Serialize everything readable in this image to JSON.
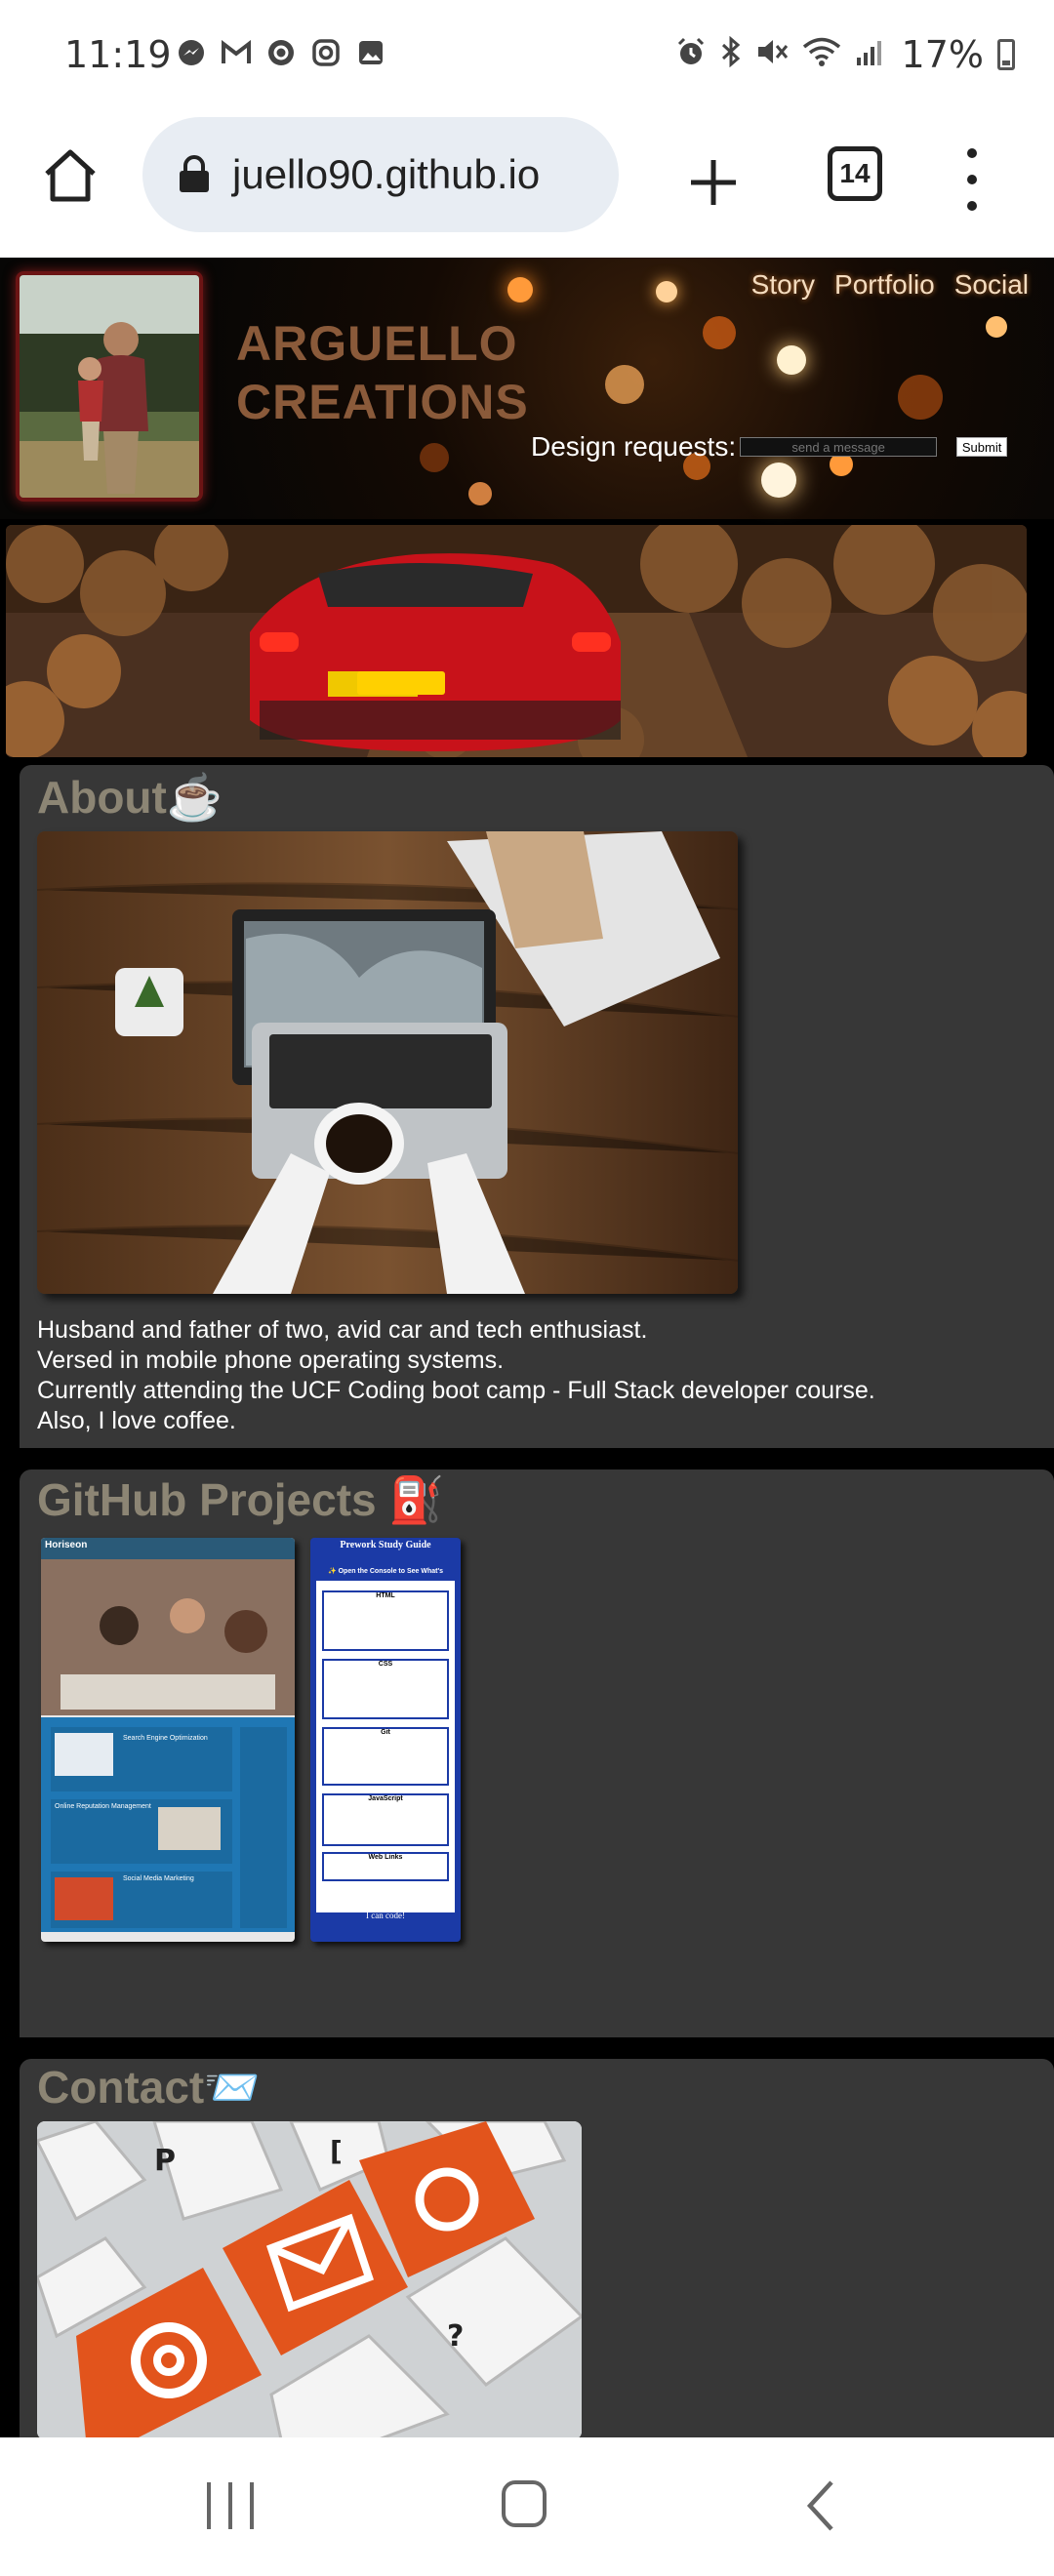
{
  "status_bar": {
    "time": "11:19",
    "battery": "17%",
    "left_icons": [
      "messenger-icon",
      "gmail-icon",
      "threads-icon",
      "instagram-icon",
      "gallery-icon"
    ],
    "right_icons": [
      "alarm-icon",
      "bluetooth-icon",
      "mute-icon",
      "wifi-icon",
      "signal-icon",
      "battery-icon"
    ]
  },
  "browser": {
    "url": "juello90.github.io",
    "tab_count": "14"
  },
  "header": {
    "brand_line1": "ARGUELLO",
    "brand_line2": "CREATIONS",
    "nav": [
      "Story",
      "Portfolio",
      "Social"
    ],
    "request_label": "Design requests:",
    "request_placeholder": "send a message",
    "submit_label": "Submit"
  },
  "about": {
    "title": "About",
    "lines": [
      "Husband and father of two, avid car and tech enthusiast.",
      "Versed in mobile phone operating systems.",
      "Currently attending the UCF Coding boot camp - Full Stack developer course.",
      "Also, I love coffee."
    ]
  },
  "github": {
    "title": "GitHub Projects",
    "projects": [
      {
        "brand": "Horiseon",
        "sections": [
          "Search Engine Optimization",
          "Online Reputation Management",
          "Social Media Marketing"
        ]
      },
      {
        "title": "Prework Study Guide",
        "banner": "✨ Open the Console to See What's",
        "topics": [
          "HTML",
          "CSS",
          "Git",
          "JavaScript",
          "Web Links"
        ],
        "footer": "I can code!"
      }
    ]
  },
  "contact": {
    "title": "Contact"
  },
  "colors": {
    "section_bg": "#373737",
    "heading": "#8c8574",
    "brand": "#8a5a3a",
    "nav_link": "#f4dcc0"
  }
}
